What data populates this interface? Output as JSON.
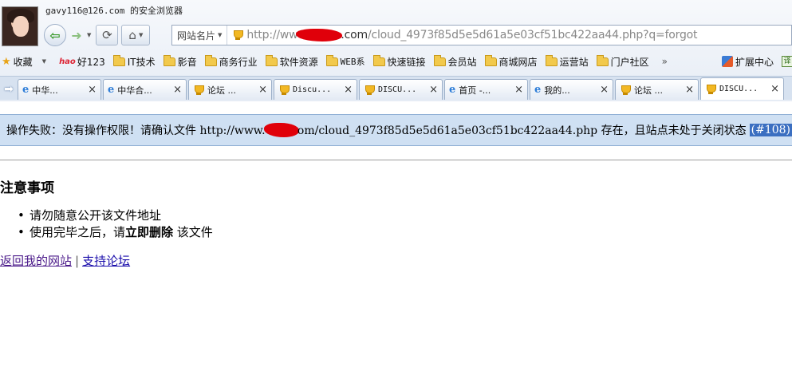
{
  "browser": {
    "user_title": "gavy116@126.com 的安全浏览器",
    "address_label": "网站名片",
    "url_prefix": "http://ww",
    "url_host_tail": ".com",
    "url_path": "/cloud_4973f85d5e5d61a5e03cf51bc422aa44.php?q=forgot"
  },
  "favorites": {
    "items": [
      "收藏",
      "好123",
      "IT技术",
      "影音",
      "商务行业",
      "软件资源",
      "WEB系",
      "快速链接",
      "会员站",
      "商城网店",
      "运营站",
      "门户社区"
    ],
    "more": "»",
    "extensions": "扩展中心",
    "translate": "译",
    "hao_badge": "hao"
  },
  "tabs": {
    "items": [
      {
        "icon": "ie",
        "label": "中华..."
      },
      {
        "icon": "ie",
        "label": "中华合..."
      },
      {
        "icon": "trophy",
        "label": "论坛 ..."
      },
      {
        "icon": "trophy",
        "label": "Discu..."
      },
      {
        "icon": "trophy",
        "label": "DISCU..."
      },
      {
        "icon": "ie",
        "label": "首页 -..."
      },
      {
        "icon": "ie",
        "label": "我的..."
      },
      {
        "icon": "trophy",
        "label": "论坛 ..."
      },
      {
        "icon": "trophy",
        "label": "DISCU..."
      }
    ],
    "close": "×"
  },
  "page": {
    "error_before": "操作失败：没有操作权限！请确认文件 http://www.",
    "error_mid": "om/cloud_4973f85d5e5d61a5e03cf51bc422aa44.php 存在，且站点未处于关闭状态",
    "error_code": "(#108)",
    "notice_title": "注意事项",
    "notice_1": "请勿随意公开该文件地址",
    "notice_2_before": "使用完毕之后，请",
    "notice_2_bold": "立即删除",
    "notice_2_after": " 该文件",
    "link_back": "返回我的网站",
    "link_sep": "|",
    "link_forum": "支持论坛"
  }
}
